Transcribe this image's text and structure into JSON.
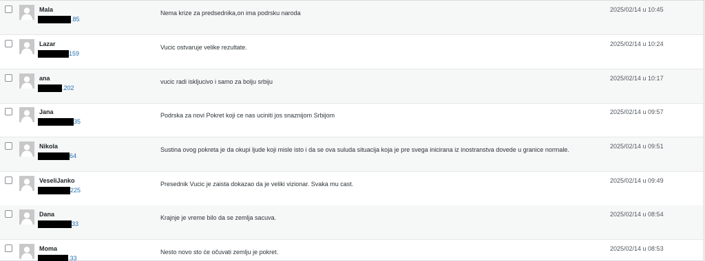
{
  "comments": [
    {
      "author": "Mala",
      "ip_suffix": ".85",
      "text": "Nema krize za predsednika,on ima podrsku naroda",
      "date": "2025/02/14 u 10:45"
    },
    {
      "author": "Lazar",
      "ip_suffix": "159",
      "text": "Vucic ostvaruje velike rezultate.",
      "date": "2025/02/14 u 10:24"
    },
    {
      "author": "ana",
      "ip_suffix": ".202",
      "text": "vucic radi iskljucivo i samo za bolju srbiju",
      "date": "2025/02/14 u 10:17"
    },
    {
      "author": "Jana",
      "ip_suffix": "35",
      "text": "Podrska za novi Pokret koji ce nas uciniti jos snaznijom Srbijom",
      "date": "2025/02/14 u 09:57"
    },
    {
      "author": "Nikola",
      "ip_suffix": "64",
      "text": "Sustina ovog pokreta je da okupi ljude koji misle isto i da se ova suluda situacija koja je pre svega inicirana iz inostranstva dovede u granice normale.",
      "date": "2025/02/14 u 09:51"
    },
    {
      "author": "VeseliJanko",
      "ip_suffix": "225",
      "text": "Presednik Vucic je zaista dokazao da je veliki vizionar. Svaka mu cast.",
      "date": "2025/02/14 u 09:49"
    },
    {
      "author": "Dana",
      "ip_suffix": "33",
      "text": "Krajnje je vreme bilo da se zemlja sacuva.",
      "date": "2025/02/14 u 08:54"
    },
    {
      "author": "Moma",
      "ip_suffix": ".33",
      "text": "Nesto novo sto će očuvati zemlju je pokret.",
      "date": "2025/02/14 u 08:53"
    }
  ]
}
